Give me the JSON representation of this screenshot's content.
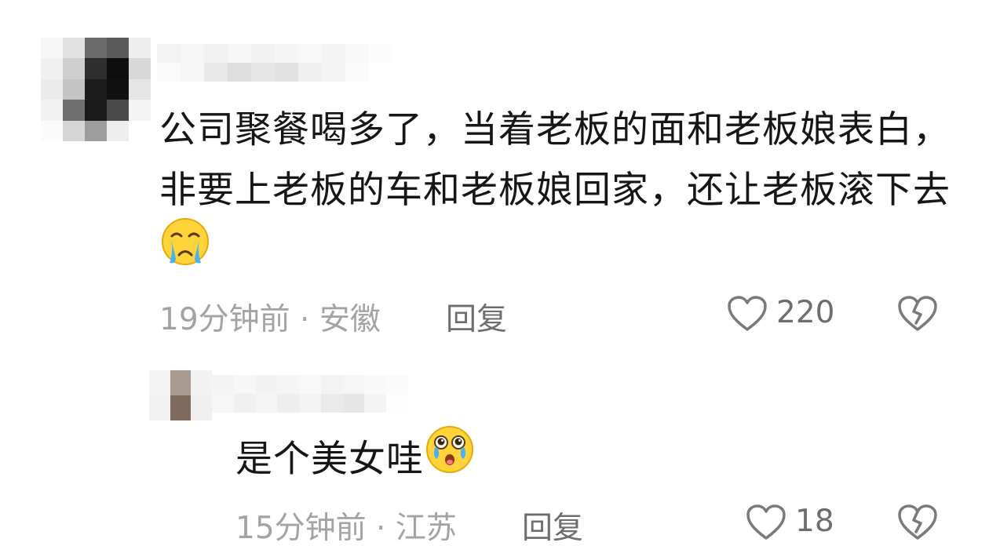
{
  "comments": [
    {
      "text": "公司聚餐喝多了，当着老板的面和老板娘表白，非要上老板的车和老板娘回家，还让老板滚下去",
      "emoji": "crying-face-emoji",
      "time": "19分钟前",
      "separator": "·",
      "location": "安徽",
      "reply_label": "回复",
      "likes": "220"
    },
    {
      "text": "是个美女哇",
      "emoji": "teary-eyed-face-emoji",
      "time": "15分钟前",
      "separator": "·",
      "location": "江苏",
      "reply_label": "回复",
      "likes": "18"
    }
  ],
  "icons": {
    "like": "heart-outline-icon",
    "dislike": "broken-heart-outline-icon"
  },
  "colors": {
    "text": "#161616",
    "meta": "#a3a3a3",
    "action": "#6e6e6e",
    "icon": "#7a7a7a"
  }
}
